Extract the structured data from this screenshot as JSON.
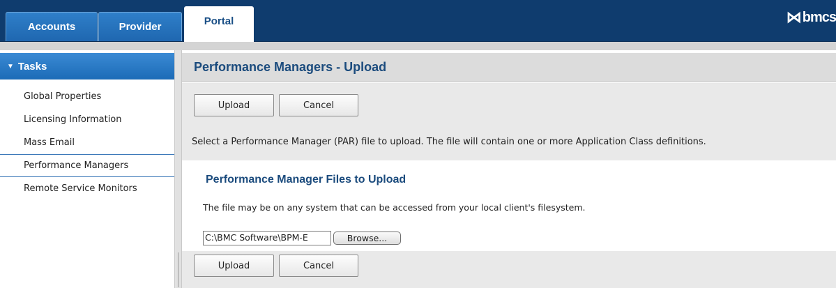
{
  "header": {
    "tabs": [
      {
        "label": "Accounts",
        "active": false
      },
      {
        "label": "Provider",
        "active": false
      },
      {
        "label": "Portal",
        "active": true
      }
    ],
    "logo_text": "bmcs"
  },
  "sidebar": {
    "section_title": "Tasks",
    "items": [
      {
        "label": "Global Properties",
        "selected": false
      },
      {
        "label": "Licensing Information",
        "selected": false
      },
      {
        "label": "Mass Email",
        "selected": false
      },
      {
        "label": "Performance Managers",
        "selected": true
      },
      {
        "label": "Remote Service Monitors",
        "selected": false
      }
    ]
  },
  "main": {
    "title": "Performance Managers - Upload",
    "buttons": {
      "upload": "Upload",
      "cancel": "Cancel"
    },
    "instructions": "Select a Performance Manager (PAR) file to upload. The file will contain one or more Application Class definitions.",
    "upload_section": {
      "heading": "Performance Manager Files to Upload",
      "description": "The file may be on any system that can be accessed from your local client's filesystem.",
      "file_value": "C:\\BMC Software\\BPM-E",
      "browse_label": "Browse..."
    }
  },
  "colors": {
    "header_bg": "#0f3c6e",
    "tab_blue": "#2f7fc9",
    "title_text": "#1b4b7d",
    "toolbar_bg": "#e9e9e9"
  }
}
